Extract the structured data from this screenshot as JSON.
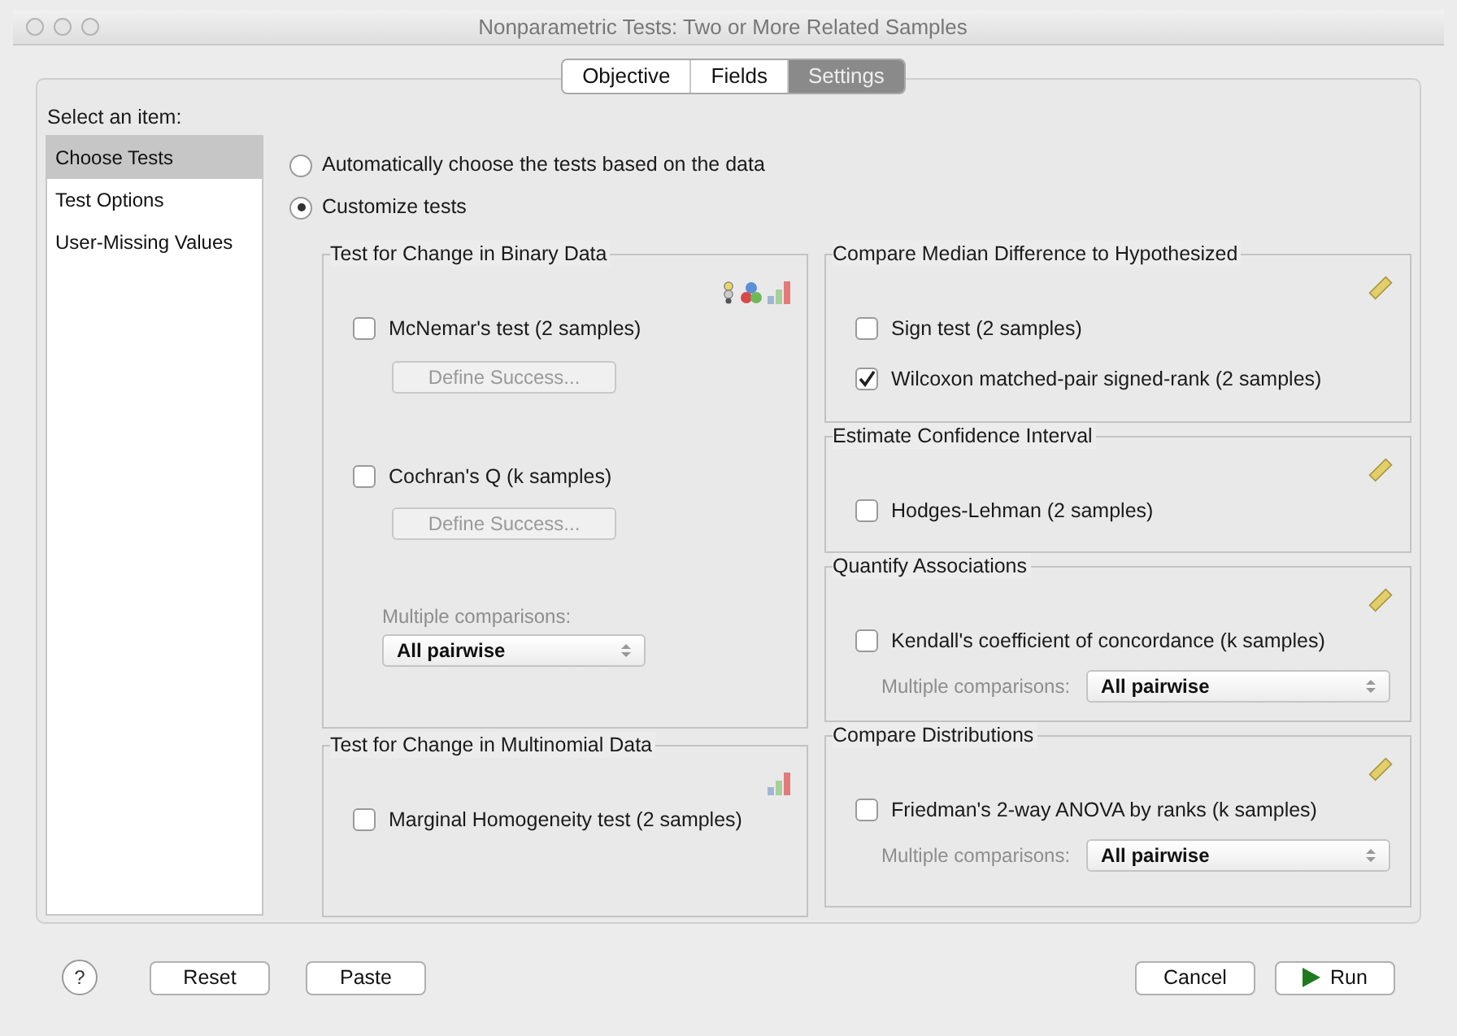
{
  "window": {
    "title": "Nonparametric Tests: Two or More Related Samples"
  },
  "tabs": [
    {
      "label": "Objective",
      "selected": false
    },
    {
      "label": "Fields",
      "selected": false
    },
    {
      "label": "Settings",
      "selected": true
    }
  ],
  "sidebar": {
    "heading": "Select an item:",
    "items": [
      {
        "label": "Choose Tests",
        "selected": true
      },
      {
        "label": "Test Options",
        "selected": false
      },
      {
        "label": "User-Missing Values",
        "selected": false
      }
    ]
  },
  "mode_options": [
    {
      "label": "Automatically choose the tests based on the data",
      "selected": false
    },
    {
      "label": "Customize tests",
      "selected": true
    }
  ],
  "left_groups": [
    {
      "title": "Test for Change in Binary Data",
      "items": [
        {
          "kind": "checkbox",
          "label": "McNemar's test (2 samples)",
          "checked": false
        },
        {
          "kind": "button",
          "label": "Define Success...",
          "disabled": true
        },
        {
          "kind": "checkbox",
          "label": "Cochran's Q (k samples)",
          "checked": false
        },
        {
          "kind": "button",
          "label": "Define Success...",
          "disabled": true
        },
        {
          "kind": "select",
          "label": "Multiple comparisons:",
          "value": "All pairwise",
          "stacked": true
        }
      ]
    },
    {
      "title": "Test for Change in Multinomial Data",
      "items": [
        {
          "kind": "checkbox",
          "label": "Marginal Homogeneity test (2 samples)",
          "checked": false
        }
      ]
    }
  ],
  "right_groups": [
    {
      "title": "Compare Median Difference to Hypothesized",
      "items": [
        {
          "kind": "checkbox",
          "label": "Sign test (2 samples)",
          "checked": false
        },
        {
          "kind": "checkbox",
          "label": "Wilcoxon matched-pair signed-rank (2 samples)",
          "checked": true
        }
      ]
    },
    {
      "title": "Estimate Confidence Interval",
      "items": [
        {
          "kind": "checkbox",
          "label": "Hodges-Lehman (2 samples)",
          "checked": false
        }
      ]
    },
    {
      "title": "Quantify Associations",
      "items": [
        {
          "kind": "checkbox",
          "label": "Kendall's coefficient of concordance (k samples)",
          "checked": false
        },
        {
          "kind": "select",
          "label": "Multiple comparisons:",
          "value": "All pairwise",
          "stacked": false
        }
      ]
    },
    {
      "title": "Compare Distributions",
      "items": [
        {
          "kind": "checkbox",
          "label": "Friedman's 2-way ANOVA by ranks (k samples)",
          "checked": false
        },
        {
          "kind": "select",
          "label": "Multiple comparisons:",
          "value": "All pairwise",
          "stacked": false
        }
      ]
    }
  ],
  "footer": {
    "help": "?",
    "left_buttons": [
      "Reset",
      "Paste"
    ],
    "right_buttons": [
      "Cancel",
      "Run"
    ]
  }
}
